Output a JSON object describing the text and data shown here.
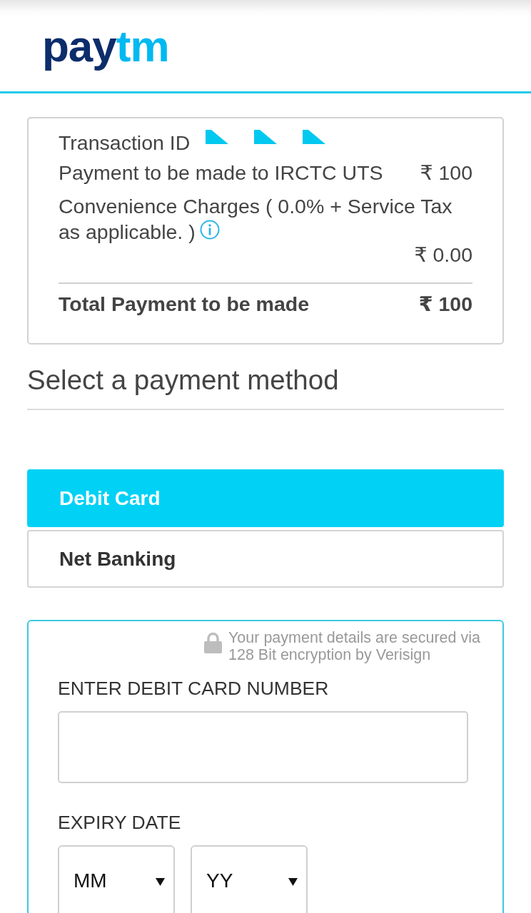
{
  "header": {
    "logo": [
      {
        "text": "pay",
        "color": "#0c2d6b"
      },
      {
        "text": "tm",
        "color": "#00b9f1"
      }
    ]
  },
  "summary": {
    "transaction_id_label": "Transaction ID",
    "rows": [
      {
        "kind": "inline",
        "label": "Payment to be made to IRCTC UTS",
        "amount": "₹ 100",
        "info": false
      },
      {
        "kind": "stacked",
        "label": "Convenience Charges ( 0.0% + Service Tax as applicable. )",
        "amount": "₹ 0.00",
        "info": true
      }
    ],
    "total": {
      "label": "Total Payment to be made",
      "amount": "₹ 100"
    }
  },
  "section_title": "Select a payment method",
  "payment_methods": [
    {
      "label": "Debit Card",
      "selected": true
    },
    {
      "label": "Net Banking",
      "selected": false
    }
  ],
  "card_form": {
    "security_note": "Your payment details are secured via 128 Bit encryption by Verisign",
    "card_number": {
      "label": "ENTER DEBIT CARD NUMBER"
    },
    "expiry": {
      "label": "EXPIRY DATE",
      "month": {
        "value": "MM"
      },
      "year": {
        "value": "YY"
      }
    }
  }
}
